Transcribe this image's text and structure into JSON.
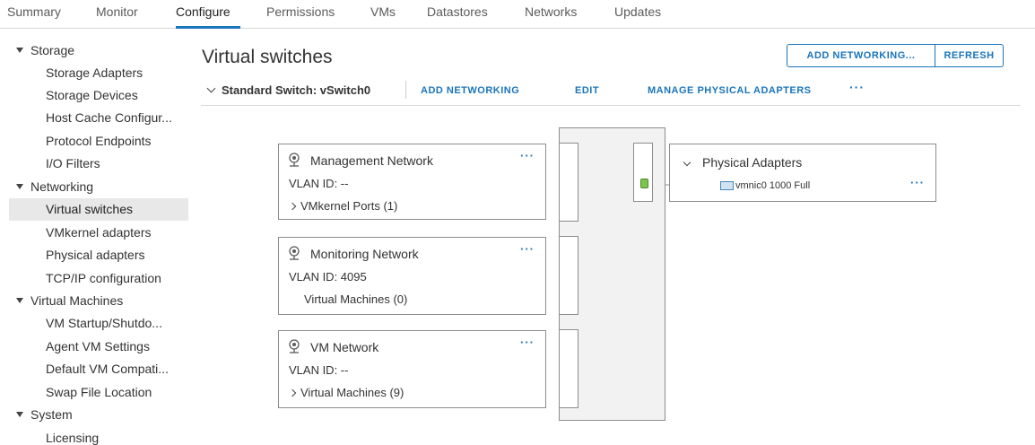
{
  "tabs": [
    {
      "label": "Summary"
    },
    {
      "label": "Monitor"
    },
    {
      "label": "Configure"
    },
    {
      "label": "Permissions"
    },
    {
      "label": "VMs"
    },
    {
      "label": "Datastores"
    },
    {
      "label": "Networks"
    },
    {
      "label": "Updates"
    }
  ],
  "active_tab": "Configure",
  "sidebar": {
    "items": [
      {
        "label": "Storage"
      },
      {
        "label": "Storage Adapters"
      },
      {
        "label": "Storage Devices"
      },
      {
        "label": "Host Cache Configur..."
      },
      {
        "label": "Protocol Endpoints"
      },
      {
        "label": "I/O Filters"
      },
      {
        "label": "Networking"
      },
      {
        "label": "Virtual switches"
      },
      {
        "label": "VMkernel adapters"
      },
      {
        "label": "Physical adapters"
      },
      {
        "label": "TCP/IP configuration"
      },
      {
        "label": "Virtual Machines"
      },
      {
        "label": "VM Startup/Shutdo..."
      },
      {
        "label": "Agent VM Settings"
      },
      {
        "label": "Default VM Compati..."
      },
      {
        "label": "Swap File Location"
      },
      {
        "label": "System"
      },
      {
        "label": "Licensing"
      }
    ],
    "selected": "Virtual switches"
  },
  "main": {
    "title": "Virtual switches",
    "add_networking_button": "ADD NETWORKING...",
    "refresh_button": "REFRESH",
    "switch": {
      "title": "Standard Switch: vSwitch0",
      "actions": {
        "add_networking": "ADD NETWORKING",
        "edit": "EDIT",
        "manage_physical_adapters": "MANAGE PHYSICAL ADAPTERS",
        "more": "···"
      }
    },
    "port_groups": [
      {
        "name": "Management Network",
        "vlan": "VLAN ID: --",
        "sub": "VMkernel Ports (1)",
        "dots": "···"
      },
      {
        "name": "Monitoring Network",
        "vlan": "VLAN ID: 4095",
        "sub": "Virtual Machines (0)",
        "dots": "···"
      },
      {
        "name": "VM Network",
        "vlan": "VLAN ID: --",
        "sub": "Virtual Machines (9)",
        "dots": "···"
      }
    ],
    "physical_adapters": {
      "title": "Physical Adapters",
      "items": [
        {
          "label": "vmnic0 1000 Full"
        }
      ],
      "dots": "···"
    }
  },
  "colors": {
    "accent": "#1b75bb",
    "uplink_green": "#7dc44c"
  }
}
